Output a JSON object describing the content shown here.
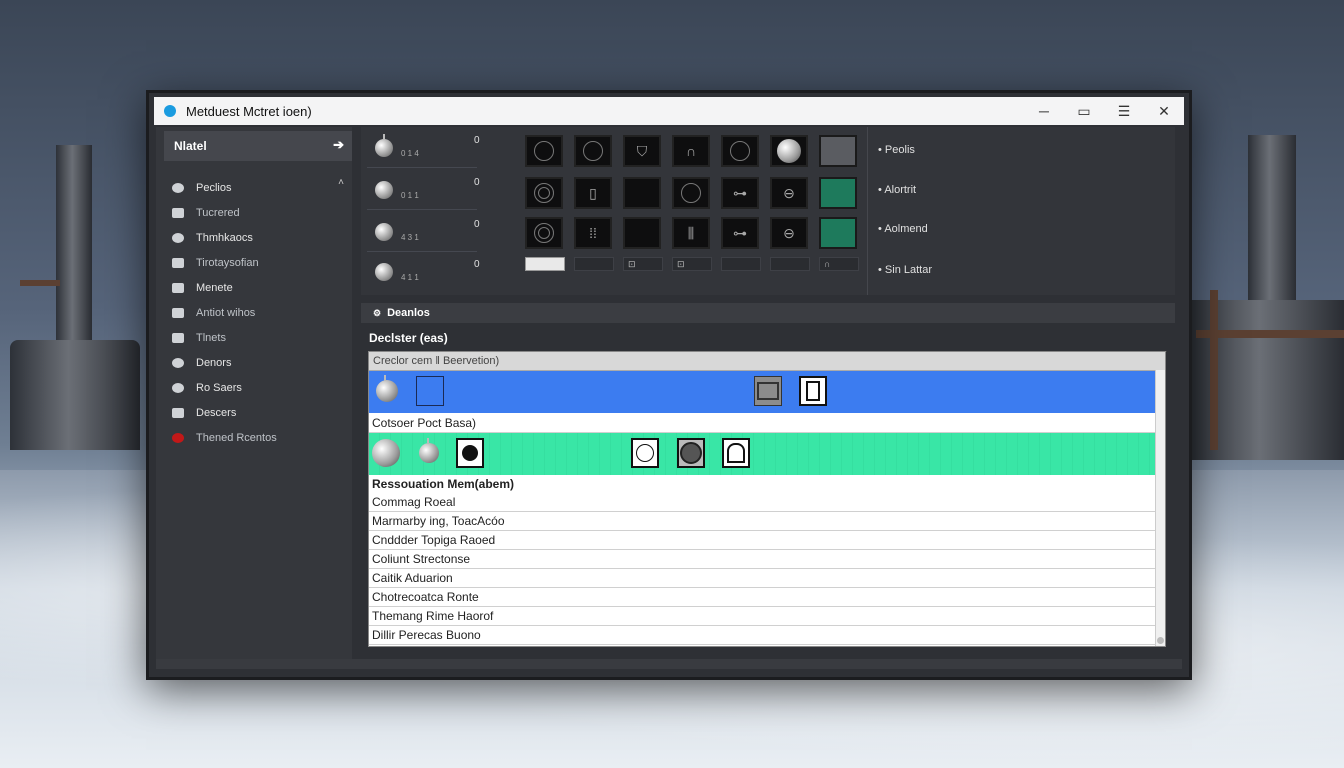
{
  "window": {
    "title": "Metduest Mctret ioen)",
    "controls": {
      "minimize": "─",
      "maximize": "▭",
      "restore": "☰",
      "close": "✕"
    }
  },
  "sidebar": {
    "header": "Nlatel",
    "header_arrow": "➔",
    "items": [
      {
        "label": "Peclios",
        "icon": "folder-icon",
        "caret": "˄"
      },
      {
        "label": "Tucrered",
        "icon": "image-icon"
      },
      {
        "label": "Thmhkaocs",
        "icon": "globe-icon"
      },
      {
        "label": "Tirotaysofian",
        "icon": "image-icon"
      },
      {
        "label": "Menete",
        "icon": "image-icon"
      },
      {
        "label": "Antiot wihos",
        "icon": "image-icon"
      },
      {
        "label": "Tlnets",
        "icon": "image-icon"
      },
      {
        "label": "Denors",
        "icon": "globe-icon"
      },
      {
        "label": "Ro Saers",
        "icon": "record-icon"
      },
      {
        "label": "Descers",
        "icon": "grid-icon"
      },
      {
        "label": "Thened Rcentos",
        "icon": "red-dot-icon"
      }
    ]
  },
  "knobs": [
    {
      "sub": "0 1 4",
      "value": "0"
    },
    {
      "sub": "0 1 1",
      "value": "0"
    },
    {
      "sub": "4 3 1",
      "value": "0"
    },
    {
      "sub": "4 1 1",
      "value": "0"
    }
  ],
  "pad_slots": [
    "",
    "",
    "⊡",
    "⊡",
    "",
    "",
    "∩"
  ],
  "right_list": [
    "Peolis",
    "Alortrit",
    "Aolmend",
    "Sin Lattar"
  ],
  "details": {
    "header": "Deanlos",
    "subheader": "Declster (eas)",
    "table_header": "Creclor cem ‖ Beervetion)",
    "row_after_blue": "Cotsoer Poct Basa)",
    "section_label": "Ressouation  Mem(abem)",
    "rows": [
      "Commag Roeal",
      "Marmarby ing, ToacAcóo",
      "Cnddder Topiga Raoed",
      "Coliunt Strectonse",
      "Caitik Aduarion",
      "Chotrecoatca Ronte",
      "Themang Rime Haorof",
      "Dillir Perecas Buono"
    ]
  },
  "colors": {
    "accent_blue": "#3c7cf0",
    "accent_green": "#39e6a6",
    "pad_green": "#1e7a5c",
    "title_dot": "#1a9be0",
    "alert_red": "#c21818"
  }
}
